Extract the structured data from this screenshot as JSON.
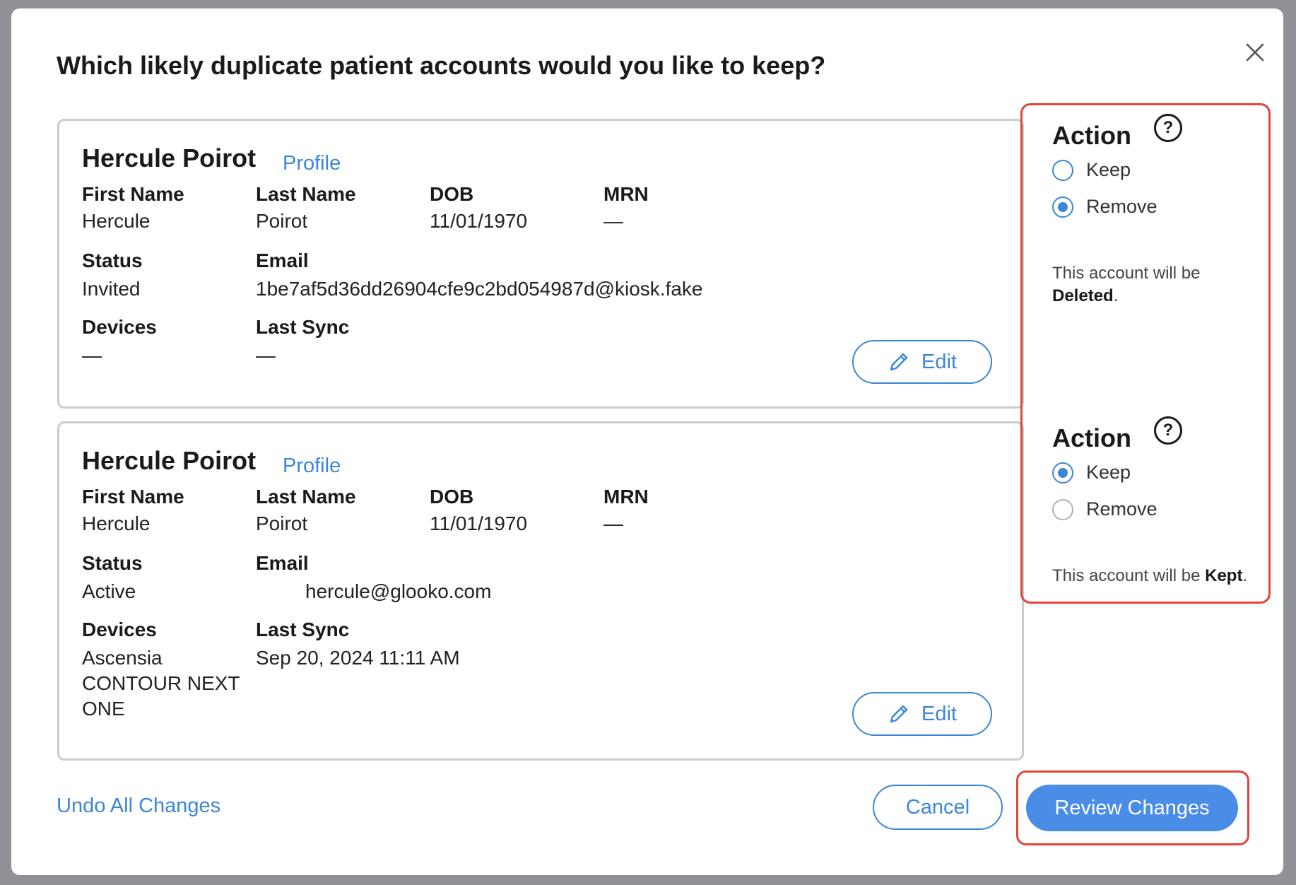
{
  "dialog": {
    "title": "Which likely duplicate patient accounts would you like to keep?",
    "close_icon": "close-icon"
  },
  "labels": {
    "first_name": "First Name",
    "last_name": "Last Name",
    "dob": "DOB",
    "mrn": "MRN",
    "status": "Status",
    "email": "Email",
    "devices": "Devices",
    "last_sync": "Last Sync"
  },
  "accounts": [
    {
      "name": "Hercule Poirot",
      "profile_link": "Profile",
      "first_name": "Hercule",
      "last_name": "Poirot",
      "dob": "11/01/1970",
      "mrn": "—",
      "status": "Invited",
      "email": "1be7af5d36dd26904cfe9c2bd054987d@kiosk.fake",
      "devices": "—",
      "last_sync": "—",
      "edit_label": "Edit"
    },
    {
      "name": "Hercule Poirot",
      "profile_link": "Profile",
      "first_name": "Hercule",
      "last_name": "Poirot",
      "dob": "11/01/1970",
      "mrn": "—",
      "status": "Active",
      "email": "hercule@glooko.com",
      "devices": "Ascensia CONTOUR NEXT ONE",
      "last_sync": "Sep 20, 2024 11:11 AM",
      "edit_label": "Edit"
    }
  ],
  "actions": [
    {
      "title": "Action",
      "help_icon": "?",
      "options": [
        "Keep",
        "Remove"
      ],
      "selected": "Remove",
      "note_prefix": "This account will be",
      "note_result": "Deleted"
    },
    {
      "title": "Action",
      "help_icon": "?",
      "options": [
        "Keep",
        "Remove"
      ],
      "selected": "Keep",
      "note_prefix": "This account will be",
      "note_result": "Kept"
    }
  ],
  "footer": {
    "undo_label": "Undo All Changes",
    "cancel_label": "Cancel",
    "review_label": "Review Changes"
  },
  "colors": {
    "accent": "#3a86d8",
    "primary_button": "#4a8de6",
    "highlight": "#e2453a"
  }
}
